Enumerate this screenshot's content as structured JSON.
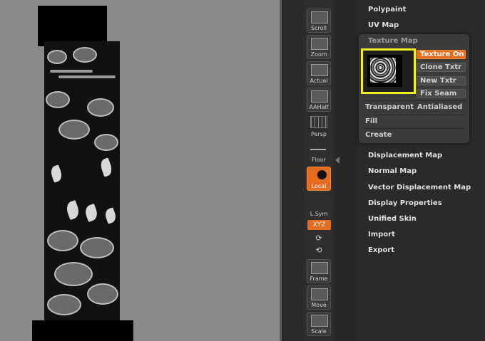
{
  "toolbar": {
    "buttons": [
      {
        "label": "Scroll",
        "icon": "scroll-icon"
      },
      {
        "label": "Zoom",
        "icon": "zoom-icon"
      },
      {
        "label": "Actual",
        "icon": "actual-icon"
      },
      {
        "label": "AAHalf",
        "icon": "aahalf-icon"
      },
      {
        "label": "Persp",
        "icon": "persp-icon"
      },
      {
        "label": "Floor",
        "icon": "floor-icon"
      },
      {
        "label": "Local",
        "icon": "local-icon"
      },
      {
        "label": "L.Sym",
        "icon": "lsym-icon"
      },
      {
        "label": "Frame",
        "icon": "frame-icon"
      },
      {
        "label": "Move",
        "icon": "move-icon"
      },
      {
        "label": "Scale",
        "icon": "scale-icon"
      }
    ],
    "xyz_label": "XYZ"
  },
  "menu": {
    "polypaint": "Polypaint",
    "uv_map": "UV Map",
    "displacement_map": "Displacement Map",
    "normal_map": "Normal Map",
    "vector_displacement_map": "Vector Displacement Map",
    "display_properties": "Display Properties",
    "unified_skin": "Unified Skin",
    "import": "Import",
    "export": "Export"
  },
  "texture_popup": {
    "title": "Texture Map",
    "texture_on": "Texture On",
    "clone_txtr": "Clone Txtr",
    "new_txtr": "New Txtr",
    "fix_seam": "Fix Seam",
    "transparent": "Transparent",
    "antialiased": "Antialiased",
    "fill": "Fill",
    "create": "Create"
  },
  "colors": {
    "accent": "#e56b1f",
    "highlight_frame": "#f0f01a"
  }
}
